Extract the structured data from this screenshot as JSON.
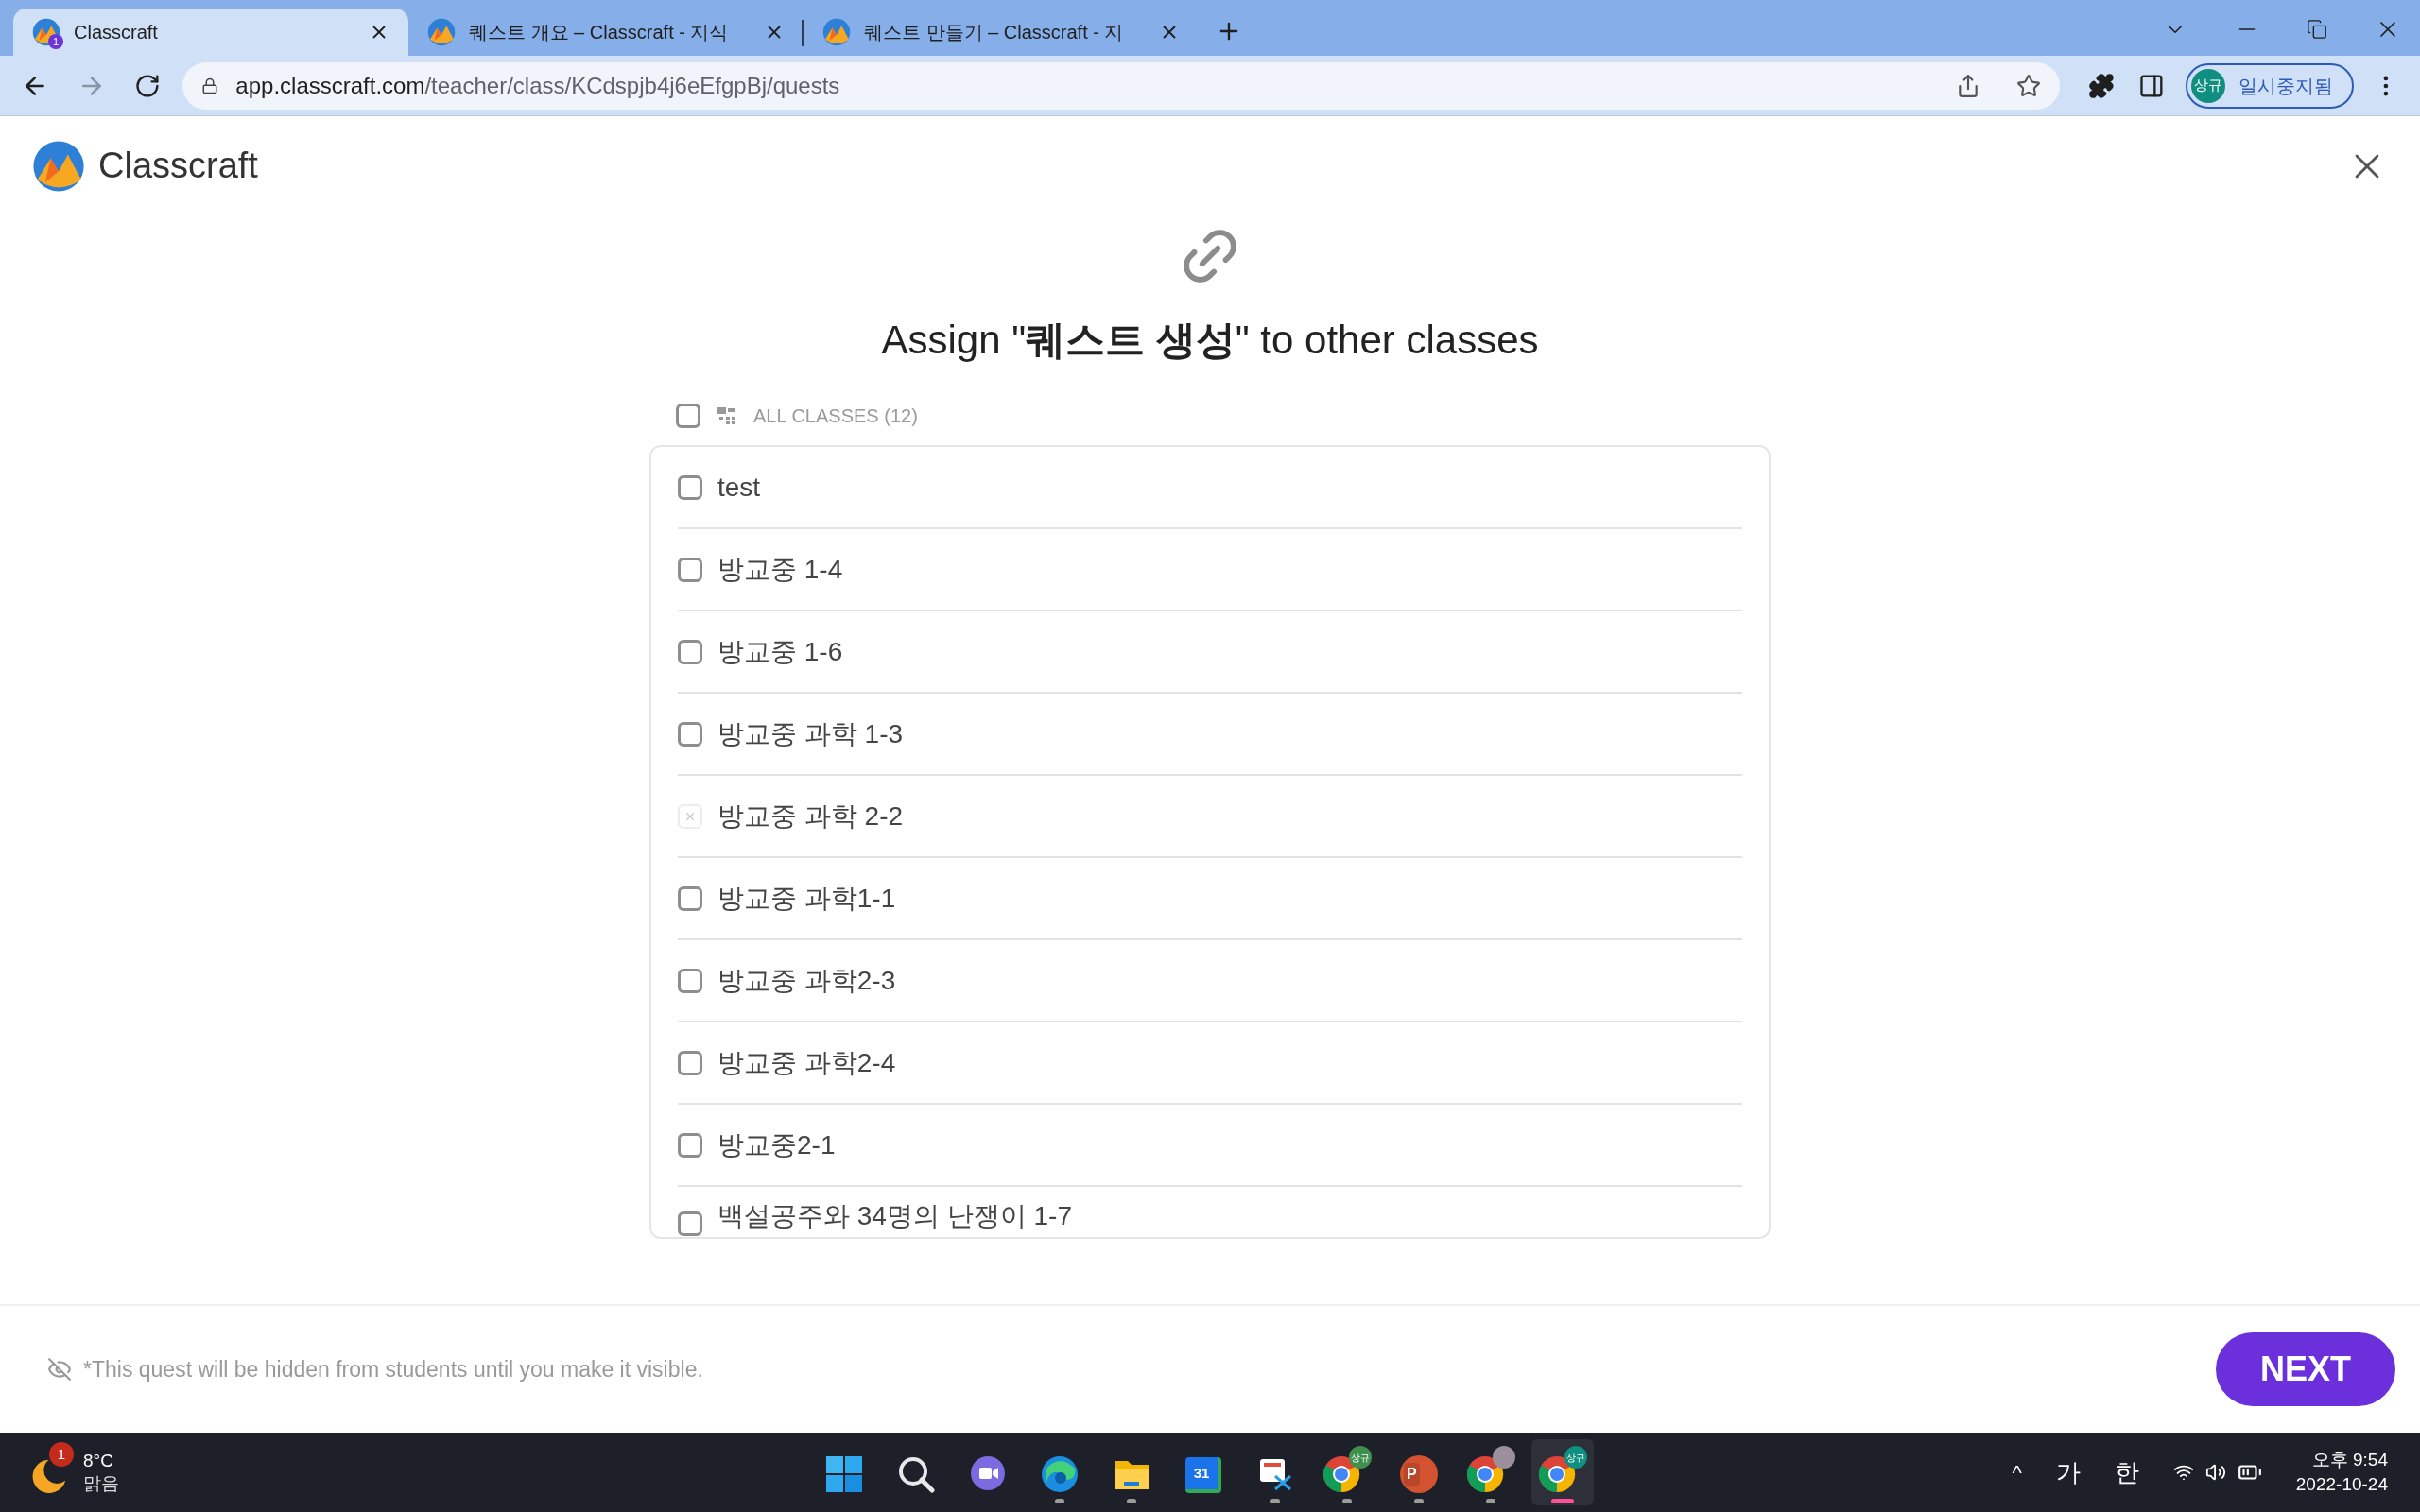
{
  "browser": {
    "tabs": [
      {
        "title": "Classcraft",
        "selected": true,
        "badge": "1"
      },
      {
        "title": "퀘스트 개요 – Classcraft - 지식",
        "selected": false
      },
      {
        "title": "퀘스트 만들기 – Classcraft - 지",
        "selected": false
      }
    ],
    "url_host": "app.classcraft.com",
    "url_path": "/teacher/class/KCdspjb4j6eEfgpBj/quests",
    "profile": {
      "initials": "상규",
      "status": "일시중지됨"
    }
  },
  "app": {
    "logo_text": "Classcraft"
  },
  "dialog": {
    "title": "Assign \"**퀘스트 생성**\" to other classes",
    "all_classes": {
      "label": "ALL CLASSES (12)",
      "checked": false
    },
    "classes": [
      {
        "name": "test",
        "checked": false,
        "disabled": false
      },
      {
        "name": "방교중 1-4",
        "checked": false,
        "disabled": false
      },
      {
        "name": "방교중 1-6",
        "checked": false,
        "disabled": false
      },
      {
        "name": "방교중 과학 1-3",
        "checked": false,
        "disabled": false
      },
      {
        "name": "방교중 과학 2-2",
        "checked": false,
        "disabled": true
      },
      {
        "name": "방교중 과학1-1",
        "checked": false,
        "disabled": false
      },
      {
        "name": "방교중 과학2-3",
        "checked": false,
        "disabled": false
      },
      {
        "name": "방교중 과학2-4",
        "checked": false,
        "disabled": false
      },
      {
        "name": "방교중2-1",
        "checked": false,
        "disabled": false
      },
      {
        "name": "백설공주와 34명의 난쟁이 1-7",
        "checked": false,
        "disabled": false
      }
    ],
    "footer_note": "*This quest will be hidden from students until you make it visible.",
    "next_button": "NEXT"
  },
  "taskbar": {
    "weather": {
      "badge": "1",
      "temperature": "8°C",
      "condition": "맑음"
    },
    "apps": [
      {
        "kind": "windows",
        "running": false,
        "active": false
      },
      {
        "kind": "search",
        "running": false,
        "active": false
      },
      {
        "kind": "chat",
        "running": false,
        "active": false
      },
      {
        "kind": "edge",
        "running": true,
        "active": false
      },
      {
        "kind": "folder",
        "running": true,
        "active": false
      },
      {
        "kind": "calendar",
        "running": false,
        "active": false,
        "label": "31"
      },
      {
        "kind": "snip",
        "running": true,
        "active": false
      },
      {
        "kind": "chrome",
        "running": true,
        "active": false,
        "badge": "상규",
        "color": "#3f8f4f"
      },
      {
        "kind": "powerpoint",
        "running": true,
        "active": false,
        "label": "P"
      },
      {
        "kind": "chrome",
        "running": true,
        "active": false,
        "avatar": true
      },
      {
        "kind": "chrome",
        "running": true,
        "active": true,
        "badge": "상규",
        "color": "#0f8f7f"
      }
    ],
    "tray": {
      "overflow": "^",
      "ime_1": "가",
      "ime_2": "한",
      "time": "오후 9:54",
      "date": "2022-10-24"
    }
  }
}
